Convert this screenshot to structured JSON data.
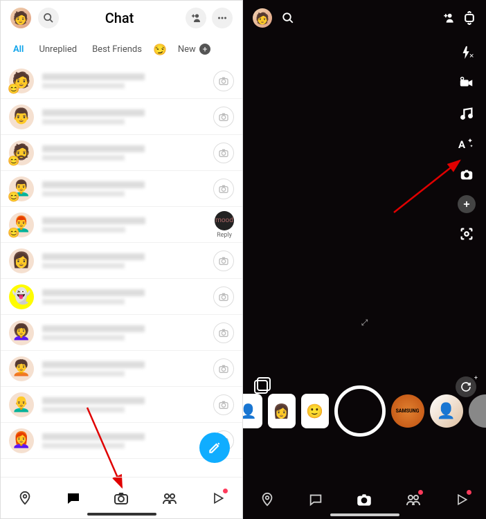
{
  "left": {
    "header": {
      "title": "Chat"
    },
    "filters": {
      "all": "All",
      "unreplied": "Unreplied",
      "best_friends": "Best Friends",
      "new_label": "New"
    },
    "reply_label": "Reply",
    "chat_rows": [
      {
        "emoji": "😊",
        "has_emoji": true,
        "ghost": false,
        "reply": false
      },
      {
        "emoji": "",
        "has_emoji": false,
        "ghost": false,
        "reply": false
      },
      {
        "emoji": "😊",
        "has_emoji": true,
        "ghost": false,
        "reply": false
      },
      {
        "emoji": "😊",
        "has_emoji": true,
        "ghost": false,
        "reply": false
      },
      {
        "emoji": "😊",
        "has_emoji": true,
        "ghost": false,
        "reply": true
      },
      {
        "emoji": "",
        "has_emoji": false,
        "ghost": false,
        "reply": false
      },
      {
        "emoji": "",
        "has_emoji": false,
        "ghost": true,
        "reply": false
      },
      {
        "emoji": "",
        "has_emoji": false,
        "ghost": false,
        "reply": false
      },
      {
        "emoji": "",
        "has_emoji": false,
        "ghost": false,
        "reply": false
      },
      {
        "emoji": "",
        "has_emoji": false,
        "ghost": false,
        "reply": false
      },
      {
        "emoji": "",
        "has_emoji": false,
        "ghost": false,
        "reply": false
      }
    ]
  },
  "right": {
    "lens_samsung": "SAMSUNG"
  }
}
